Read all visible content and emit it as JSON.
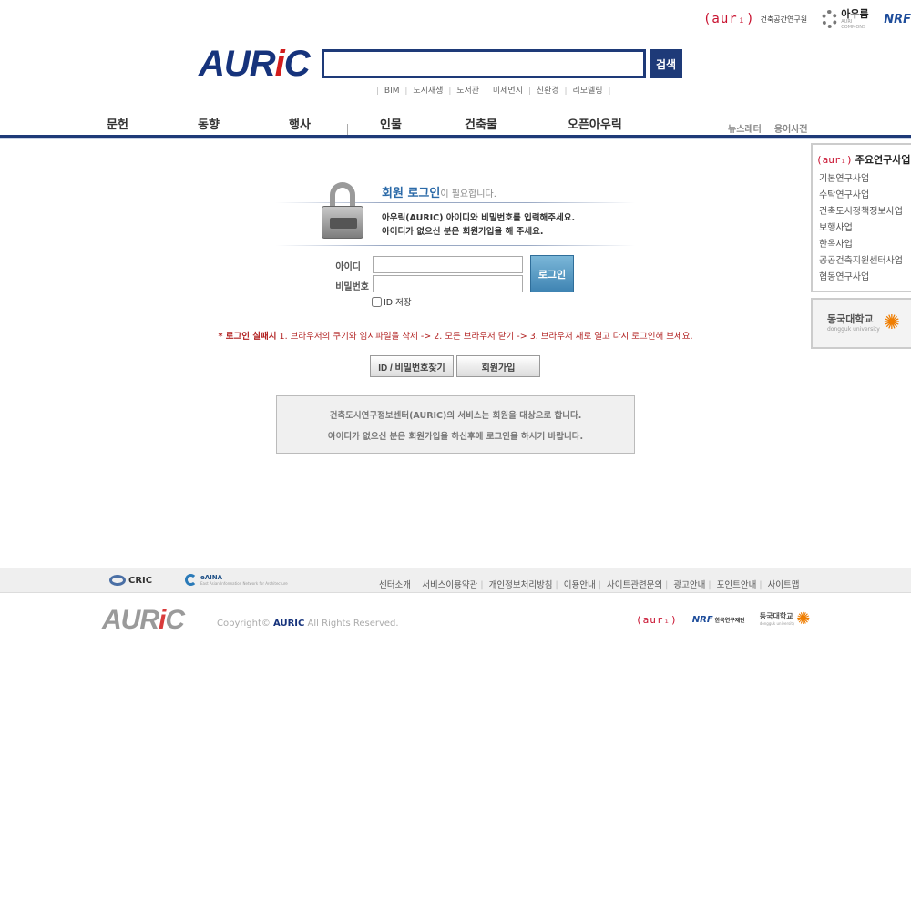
{
  "top_partners": {
    "auri_mark": "(aurᵢ)",
    "auri_name": "건축공간연구원",
    "auhoom": "아우름",
    "auhoom_sub": "AURI COMMONS",
    "nrf": "NRF"
  },
  "header": {
    "brand_prefix": "AUR",
    "brand_i": "i",
    "brand_suffix": "C",
    "search_value": "",
    "search_button": "검색",
    "quick_links": [
      "BIM",
      "도시재생",
      "도서관",
      "미세먼지",
      "친환경",
      "리모델링"
    ]
  },
  "nav": {
    "items": [
      "문헌",
      "동향",
      "행사",
      "인물",
      "건축물",
      "오픈아우릭"
    ],
    "sub_items": [
      "뉴스레터",
      "용어사전"
    ]
  },
  "sidebar": {
    "auri_mark": "(aurᵢ)",
    "title": "주요연구사업",
    "items": [
      "기본연구사업",
      "수탁연구사업",
      "건축도시정책정보사업",
      "보행사업",
      "한옥사업",
      "공공건축지원센터사업",
      "협동연구사업"
    ],
    "dongguk_name": "동국대학교",
    "dongguk_sub": "dongguk university"
  },
  "login": {
    "banner_title_bold": "회원 로그인",
    "banner_title_rest": "이 필요합니다.",
    "banner_line1": "아우릭(AURIC) 아이디와 비밀번호를 입력해주세요.",
    "banner_line2": "아이디가 없으신 분은 회원가입을 해 주세요.",
    "id_label": "아이디",
    "pw_label": "비밀번호",
    "id_value": "",
    "pw_value": "",
    "login_button": "로그인",
    "save_id_label": "ID 저장",
    "save_id_checked": false,
    "notice_bold": "* 로그인 실패시",
    "notice_text": " 1. 브라우저의 쿠기와 임시파일을 삭제 -> 2. 모든 브라우저 닫기 -> 3. 브라우저 새로 열고 다시 로그인해 보세요.",
    "find_button": "ID / 비밀번호찾기",
    "join_button": "회원가입",
    "info_line1": "건축도시연구정보센터(AURIC)의 서비스는 회원을 대상으로 합니다.",
    "info_line2": "아이디가 없으신 분은 회원가입을 하신후에 로그인을 하시기 바랍니다."
  },
  "footer": {
    "cric": "CRIC",
    "eaina": "eAINA",
    "eaina_sub": "East Asian Information Network for Architecture",
    "links": [
      "센터소개",
      "서비스이용약관",
      "개인정보처리방침",
      "이용안내",
      "사이트관련문의",
      "광고안내",
      "포인트안내",
      "사이트맵"
    ],
    "brand_prefix": "AUR",
    "brand_i": "i",
    "brand_suffix": "C",
    "copyright_pre": "Copyright© ",
    "copyright_brand": "AURIC",
    "copyright_post": " All Rights Reserved.",
    "auri_mark": "(aurᵢ)",
    "nrf": "NRF",
    "nrf_name": "한국연구재단",
    "dongguk_name": "동국대학교",
    "dongguk_sub": "dongguk university"
  }
}
